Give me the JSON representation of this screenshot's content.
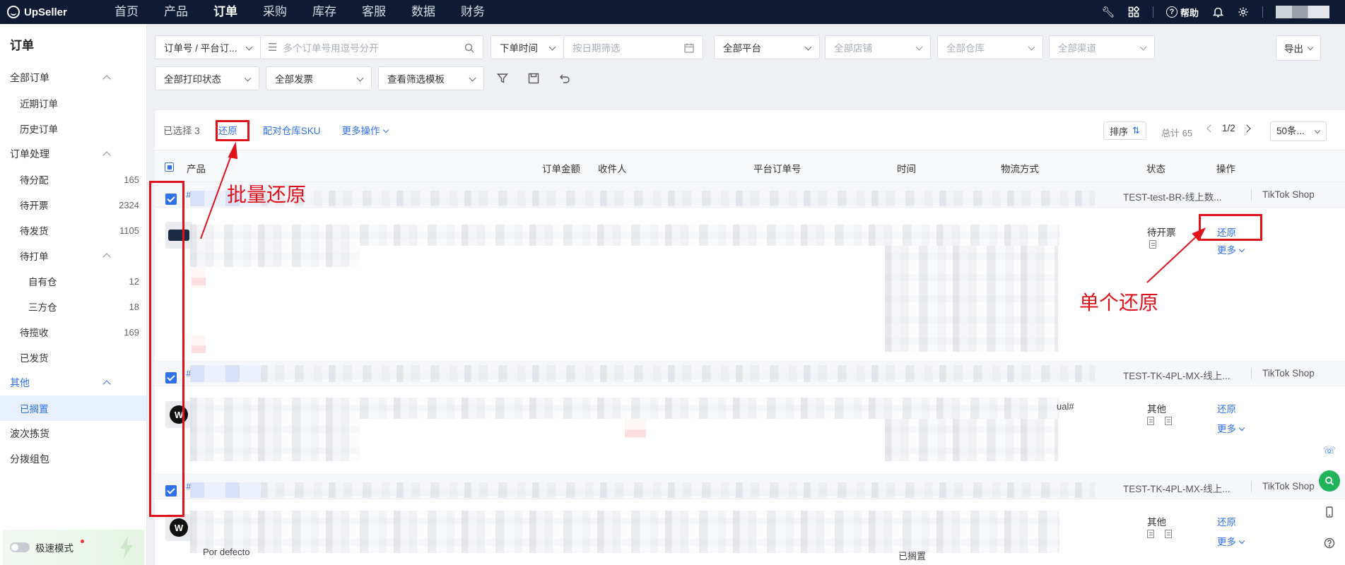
{
  "app": {
    "logo_text": "UpSeller"
  },
  "topnav": {
    "items": [
      "首页",
      "产品",
      "订单",
      "采购",
      "库存",
      "客服",
      "数据",
      "财务"
    ],
    "active_index": 2,
    "help_label": "帮助"
  },
  "sidebar": {
    "title": "订单",
    "groups": [
      {
        "label": "全部订单",
        "items": [
          {
            "label": "近期订单",
            "count": ""
          },
          {
            "label": "历史订单",
            "count": ""
          }
        ]
      },
      {
        "label": "订单处理",
        "items": [
          {
            "label": "待分配",
            "count": "165"
          },
          {
            "label": "待开票",
            "count": "2324"
          },
          {
            "label": "待发货",
            "count": "1105"
          },
          {
            "label": "待打单",
            "count": ""
          },
          {
            "label": "自有仓",
            "count": "12"
          },
          {
            "label": "三方仓",
            "count": "18"
          },
          {
            "label": "待揽收",
            "count": "169"
          },
          {
            "label": "已发货",
            "count": ""
          }
        ]
      },
      {
        "label": "其他",
        "items": [
          {
            "label": "已搁置",
            "count": ""
          }
        ]
      }
    ],
    "extra": [
      "波次拣货",
      "分拨组包"
    ],
    "turbo_label": "极速模式"
  },
  "filters": {
    "order_type": "订单号 / 平台订...",
    "order_search_placeholder": "多个订单号用逗号分开",
    "time_type": "下单时间",
    "date_placeholder": "按日期筛选",
    "platform": "全部平台",
    "shop": "全部店铺",
    "warehouse": "全部仓库",
    "channel": "全部渠道",
    "export": "导出",
    "print_status": "全部打印状态",
    "invoice": "全部发票",
    "template": "查看筛选模板"
  },
  "toolbar": {
    "selected": "已选择 3",
    "restore": "还原",
    "match_sku": "配对仓库SKU",
    "more_ops": "更多操作",
    "sort": "排序",
    "total": "总计 65",
    "page": "1/2",
    "page_size": "50条..."
  },
  "table": {
    "headers": [
      "产品",
      "订单金额",
      "收件人",
      "平台订单号",
      "时间",
      "物流方式",
      "状态",
      "操作"
    ],
    "orders": [
      {
        "hash": "#",
        "shop": "TEST-test-BR-线上数...",
        "platform": "TikTok Shop",
        "status": "待开票",
        "action": "还原",
        "more": "更多",
        "extra": ""
      },
      {
        "hash": "#",
        "shop": "TEST-TK-4PL-MX-线上...",
        "platform": "TikTok Shop",
        "status": "其他",
        "action": "还原",
        "more": "更多",
        "extra": "ual#"
      },
      {
        "hash": "#",
        "shop": "TEST-TK-4PL-MX-线上...",
        "platform": "TikTok Shop",
        "status": "其他",
        "action": "还原",
        "more": "更多",
        "extra": ""
      }
    ],
    "footer_left": "Por defecto",
    "footer_mid": "已搁置"
  },
  "annotations": {
    "batch": "批量还原",
    "single": "单个还原",
    "color": "#e0121b"
  },
  "colors": {
    "accent": "#2f6fe8",
    "nav_bg": "#0f1b33"
  }
}
